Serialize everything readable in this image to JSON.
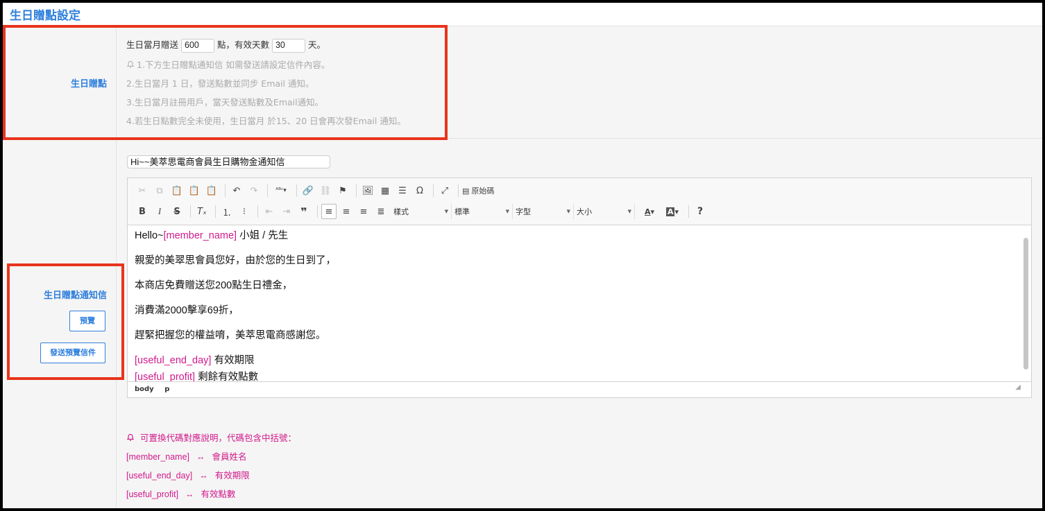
{
  "page": {
    "title": "生日贈點設定"
  },
  "gift": {
    "label": "生日贈點",
    "line1_prefix": "生日當月贈送",
    "points_value": "600",
    "line1_mid": "點，有效天數",
    "days_value": "30",
    "line1_suffix": "天。",
    "notes": [
      "1.下方生日贈點通知信 如需發送請設定信件內容。",
      "2.生日當月 1 日，發送點數並同步 Email 通知。",
      "3.生日當月註冊用戶，當天發送點數及Email通知。",
      "4.若生日點數完全未使用，生日當月 於15、20 日會再次發Email 通知。"
    ]
  },
  "notice": {
    "label": "生日贈點通知信",
    "preview_button": "預覽",
    "send_preview_button": "發送預覽信件",
    "subject_value": "Hi~~美萃思電商會員生日購物金通知信"
  },
  "editor": {
    "toolbar": {
      "source_label": "原始碼",
      "format_label": "樣式",
      "style_label": "標準",
      "font_label": "字型",
      "size_label": "大小",
      "help_label": "?"
    },
    "content": {
      "greeting_prefix": "Hello~",
      "greeting_tag": "[member_name]",
      "greeting_suffix": " 小姐 / 先生",
      "line1": "親愛的美翠思會員您好，由於您的生日到了，",
      "line2": "本商店免費贈送您200點生日禮金，",
      "line3": "消費滿2000擊享69折，",
      "line4": "趕緊把握您的權益唷，美萃思電商感謝您。",
      "end_day_tag": "[useful_end_day]",
      "end_day_text": " 有效期限",
      "profit_tag": "[useful_profit]",
      "profit_text": " 剩餘有效點數"
    },
    "status": {
      "path1": "body",
      "path2": "p"
    }
  },
  "codes": {
    "intro": "可置換代碼對應說明，代碼包含中括號：",
    "arrow": "↔",
    "items": [
      {
        "code": "[member_name]",
        "desc": "會員姓名"
      },
      {
        "code": "[useful_end_day]",
        "desc": "有效期限"
      },
      {
        "code": "[useful_profit]",
        "desc": "有效點數"
      }
    ]
  }
}
